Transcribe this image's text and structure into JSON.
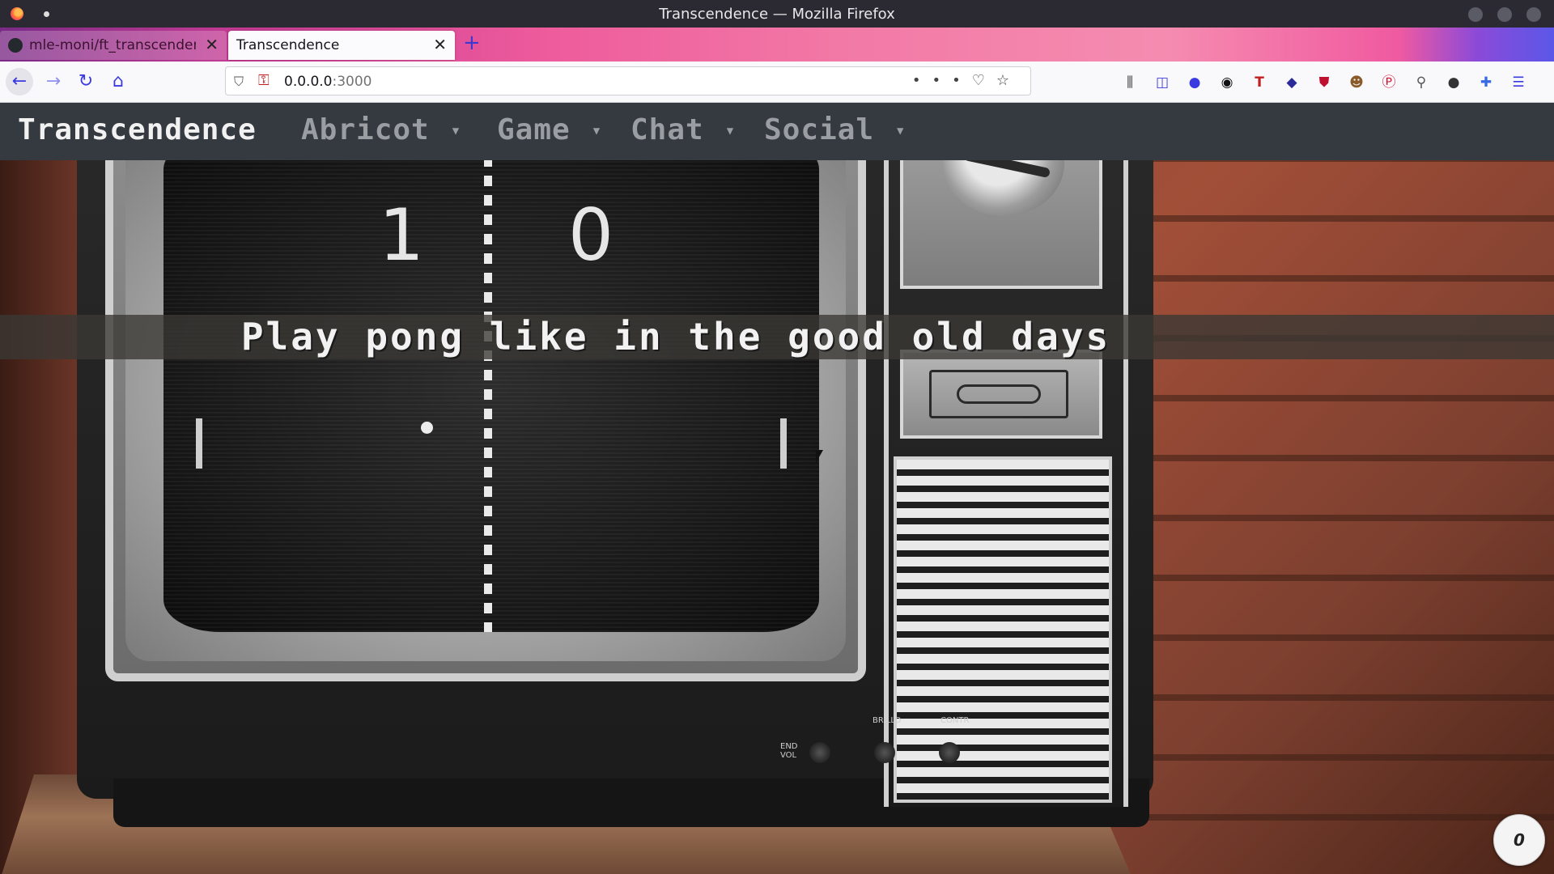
{
  "window": {
    "title": "Transcendence — Mozilla Firefox"
  },
  "tabs": [
    {
      "label": "mle-moni/ft_transcendence",
      "active": false
    },
    {
      "label": "Transcendence",
      "active": true
    }
  ],
  "urlbar": {
    "host": "0.0.0.0",
    "port": ":3000"
  },
  "app": {
    "brand": "Transcendence",
    "menu": [
      {
        "label": "Abricot"
      },
      {
        "label": "Game"
      },
      {
        "label": "Chat"
      },
      {
        "label": "Social"
      }
    ],
    "hero_text": "Play pong like in the good old days",
    "scores": {
      "left": "1",
      "right": "0"
    },
    "tv_knob_labels": {
      "left": "END VOL",
      "middle": "BRILLO",
      "right": "CONTR"
    },
    "badge_count": "0"
  },
  "colors": {
    "header_bg": "#353a40",
    "brand_text": "#f1f1f1",
    "menu_text": "#9a9da2",
    "banner_bg": "#3a3834"
  }
}
